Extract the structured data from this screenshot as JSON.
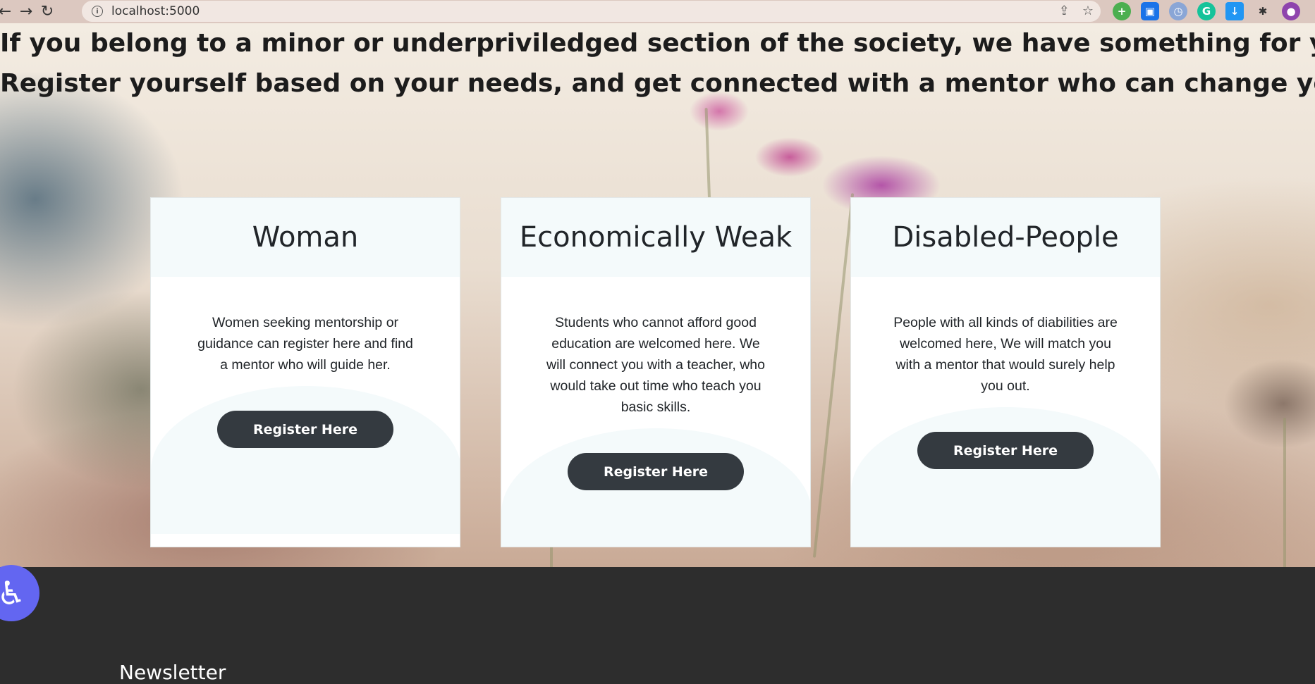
{
  "browser": {
    "url": "localhost:5000",
    "back_icon": "arrow-left-icon",
    "forward_icon": "arrow-right-icon",
    "reload_icon": "reload-icon"
  },
  "hero": {
    "headline_line1": "If you belong to a minor or underpriviledged section of the society, we have something for you.",
    "headline_line2": "Register yourself based on your needs, and get connected with a mentor who can change your life!"
  },
  "cards": [
    {
      "title": "Woman",
      "text": "Women seeking mentorship or guidance can register here and find a mentor who will guide her.",
      "button": "Register Here"
    },
    {
      "title": "Economically Weak",
      "text": "Students who cannot afford good education are welcomed here. We will connect you with a teacher, who would take out time who teach you basic skills.",
      "button": "Register Here"
    },
    {
      "title": "Disabled-People",
      "text": "People with all kinds of diabilities are welcomed here, We will match you with a mentor that would surely help you out.",
      "button": "Register Here"
    }
  ],
  "footer": {
    "newsletter_title": "Newsletter"
  },
  "colors": {
    "button": "#343a40",
    "card_header": "#f4fafb",
    "footer": "#2d2d2d",
    "accessibility": "#6366f1"
  }
}
